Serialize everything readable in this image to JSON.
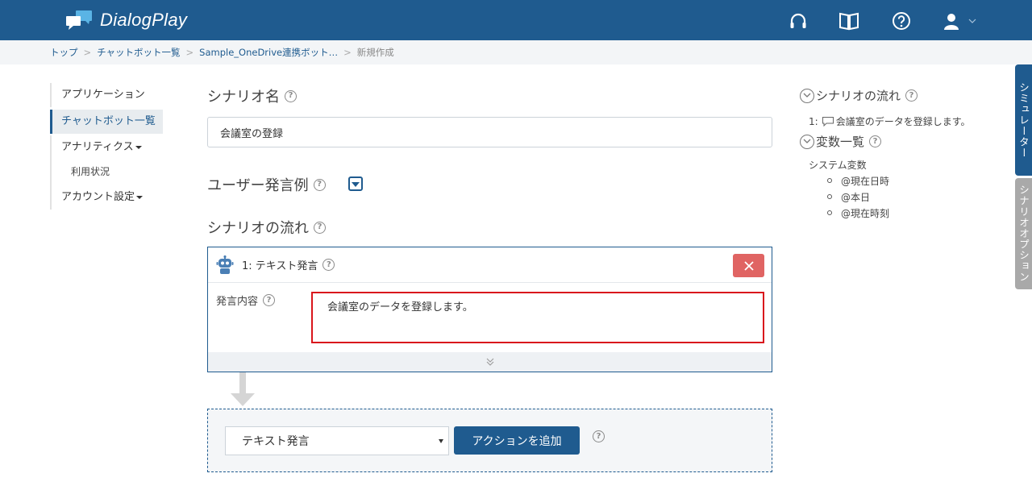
{
  "app": {
    "name": "DialogPlay"
  },
  "header": {
    "icons": [
      "headset-icon",
      "book-icon",
      "help-icon",
      "user-icon"
    ],
    "brand_color": "#1f5b8f"
  },
  "breadcrumb": {
    "items": [
      "トップ",
      "チャットボット一覧",
      "Sample_OneDrive連携ボット…"
    ],
    "current": "新規作成"
  },
  "sidebar": {
    "items": [
      {
        "label": "アプリケーション"
      },
      {
        "label": "チャットボット一覧"
      },
      {
        "label": "アナリティクス"
      },
      {
        "label": "利用状況"
      },
      {
        "label": "アカウント設定"
      }
    ]
  },
  "main": {
    "scenario_name_title": "シナリオ名",
    "scenario_name_value": "会議室の登録",
    "user_utterance_title": "ユーザー発言例",
    "flow_title": "シナリオの流れ",
    "action": {
      "title": "1: テキスト発言",
      "label": "発言内容",
      "content": "会議室のデータを登録します。"
    },
    "add": {
      "select_value": "テキスト発言",
      "button_label": "アクションを追加"
    }
  },
  "right_panel": {
    "flow_title": "シナリオの流れ",
    "flow_prefix": "1:",
    "flow_item": "会議室のデータを登録します。",
    "vars_title": "変数一覧",
    "system_vars_label": "システム変数",
    "vars": [
      "@現在日時",
      "@本日",
      "@現在時刻"
    ]
  },
  "side_tabs": {
    "simulator": "シミュレーター",
    "options": "シナリオオプション"
  }
}
